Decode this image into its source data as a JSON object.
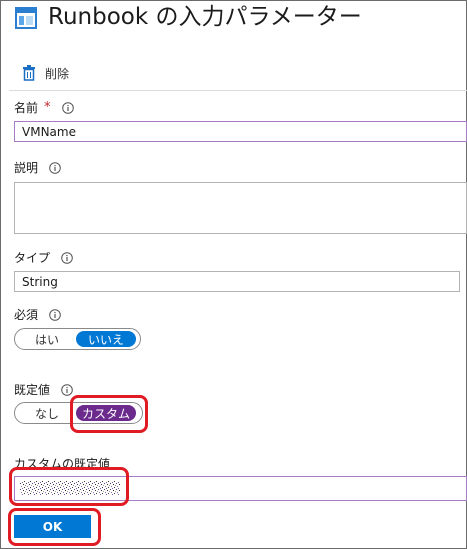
{
  "header": {
    "title": "Runbook の入力パラメーター",
    "icon": "blade-icon"
  },
  "toolbar": {
    "delete_label": "削除",
    "delete_icon": "trash-icon"
  },
  "fields": {
    "name": {
      "label": "名前",
      "required_mark": "*",
      "value": "VMName"
    },
    "description": {
      "label": "説明",
      "value": ""
    },
    "type": {
      "label": "タイプ",
      "value": "String"
    },
    "mandatory": {
      "label": "必須",
      "options": [
        "はい",
        "いいえ"
      ],
      "selected": "いいえ"
    },
    "default_value": {
      "label": "既定値",
      "options": [
        "なし",
        "カスタム"
      ],
      "selected": "カスタム"
    },
    "custom_default": {
      "label": "カスタムの既定値",
      "value_redacted": true
    }
  },
  "ok_label": "OK",
  "colors": {
    "accent_blue": "#0078d4",
    "accent_purple": "#6b2a8c",
    "highlight_red": "#e01b24"
  }
}
